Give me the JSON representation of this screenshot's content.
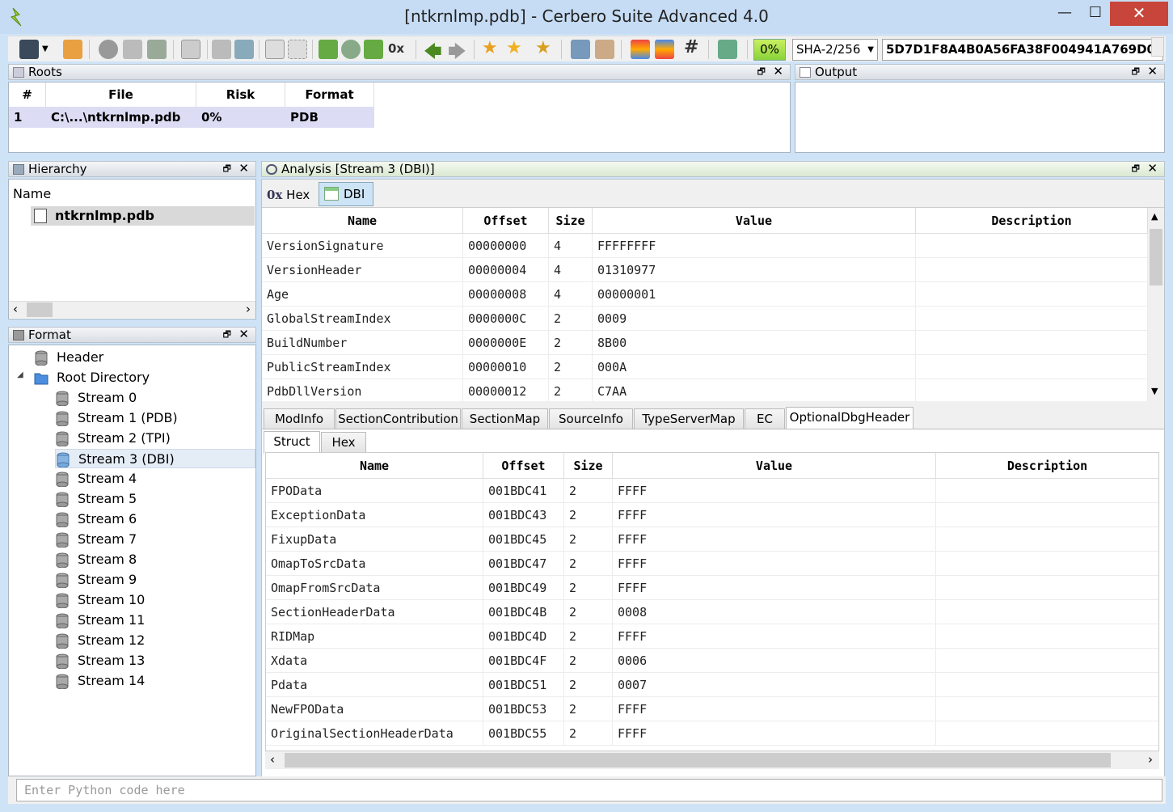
{
  "window": {
    "title": "[ntkrnlmp.pdb] - Cerbero Suite Advanced 4.0",
    "minimize": "—",
    "maximize": "☐",
    "close": "✕"
  },
  "toolbar": {
    "percent": "0%",
    "hash_algorithm": "SHA-2/256",
    "hash_value": "5D7D1F8A4B0A56FA38F004941A769D0("
  },
  "roots": {
    "title": "Roots",
    "columns": [
      "#",
      "File",
      "Risk",
      "Format"
    ],
    "rows": [
      [
        "1",
        "C:\\...\\ntkrnlmp.pdb",
        "0%",
        "PDB"
      ]
    ]
  },
  "output": {
    "title": "Output"
  },
  "hierarchy": {
    "title": "Hierarchy",
    "column": "Name",
    "item": "ntkrnlmp.pdb"
  },
  "format": {
    "title": "Format",
    "header": "Header",
    "root_directory": "Root Directory",
    "streams": [
      "Stream 0",
      "Stream 1 (PDB)",
      "Stream 2 (TPI)",
      "Stream 3 (DBI)",
      "Stream 4",
      "Stream 5",
      "Stream 6",
      "Stream 7",
      "Stream 8",
      "Stream 9",
      "Stream 10",
      "Stream 11",
      "Stream 12",
      "Stream 13",
      "Stream 14"
    ],
    "selected_index": 3
  },
  "analysis": {
    "title": "Analysis [Stream 3 (DBI)]",
    "view_tabs": [
      "Hex",
      "DBI"
    ],
    "hex_prefix": "0x",
    "columns": [
      "Name",
      "Offset",
      "Size",
      "Value",
      "Description"
    ],
    "rows": [
      [
        "VersionSignature",
        "00000000",
        "4",
        "FFFFFFFF",
        ""
      ],
      [
        "VersionHeader",
        "00000004",
        "4",
        "01310977",
        ""
      ],
      [
        "Age",
        "00000008",
        "4",
        "00000001",
        ""
      ],
      [
        "GlobalStreamIndex",
        "0000000C",
        "2",
        "0009",
        ""
      ],
      [
        "BuildNumber",
        "0000000E",
        "2",
        "8B00",
        ""
      ],
      [
        "PublicStreamIndex",
        "00000010",
        "2",
        "000A",
        ""
      ],
      [
        "PdbDllVersion",
        "00000012",
        "2",
        "C7AA",
        ""
      ]
    ],
    "section_tabs": [
      "ModInfo",
      "SectionContribution",
      "SectionMap",
      "SourceInfo",
      "TypeServerMap",
      "EC",
      "OptionalDbgHeader"
    ],
    "active_section_tab": 6,
    "sub_tabs": [
      "Struct",
      "Hex"
    ],
    "struct_rows": [
      [
        "FPOData",
        "001BDC41",
        "2",
        "FFFF",
        ""
      ],
      [
        "ExceptionData",
        "001BDC43",
        "2",
        "FFFF",
        ""
      ],
      [
        "FixupData",
        "001BDC45",
        "2",
        "FFFF",
        ""
      ],
      [
        "OmapToSrcData",
        "001BDC47",
        "2",
        "FFFF",
        ""
      ],
      [
        "OmapFromSrcData",
        "001BDC49",
        "2",
        "FFFF",
        ""
      ],
      [
        "SectionHeaderData",
        "001BDC4B",
        "2",
        "0008",
        ""
      ],
      [
        "RIDMap",
        "001BDC4D",
        "2",
        "FFFF",
        ""
      ],
      [
        "Xdata",
        "001BDC4F",
        "2",
        "0006",
        ""
      ],
      [
        "Pdata",
        "001BDC51",
        "2",
        "0007",
        ""
      ],
      [
        "NewFPOData",
        "001BDC53",
        "2",
        "FFFF",
        ""
      ],
      [
        "OriginalSectionHeaderData",
        "001BDC55",
        "2",
        "FFFF",
        ""
      ]
    ]
  },
  "python": {
    "placeholder": "Enter Python code here"
  }
}
